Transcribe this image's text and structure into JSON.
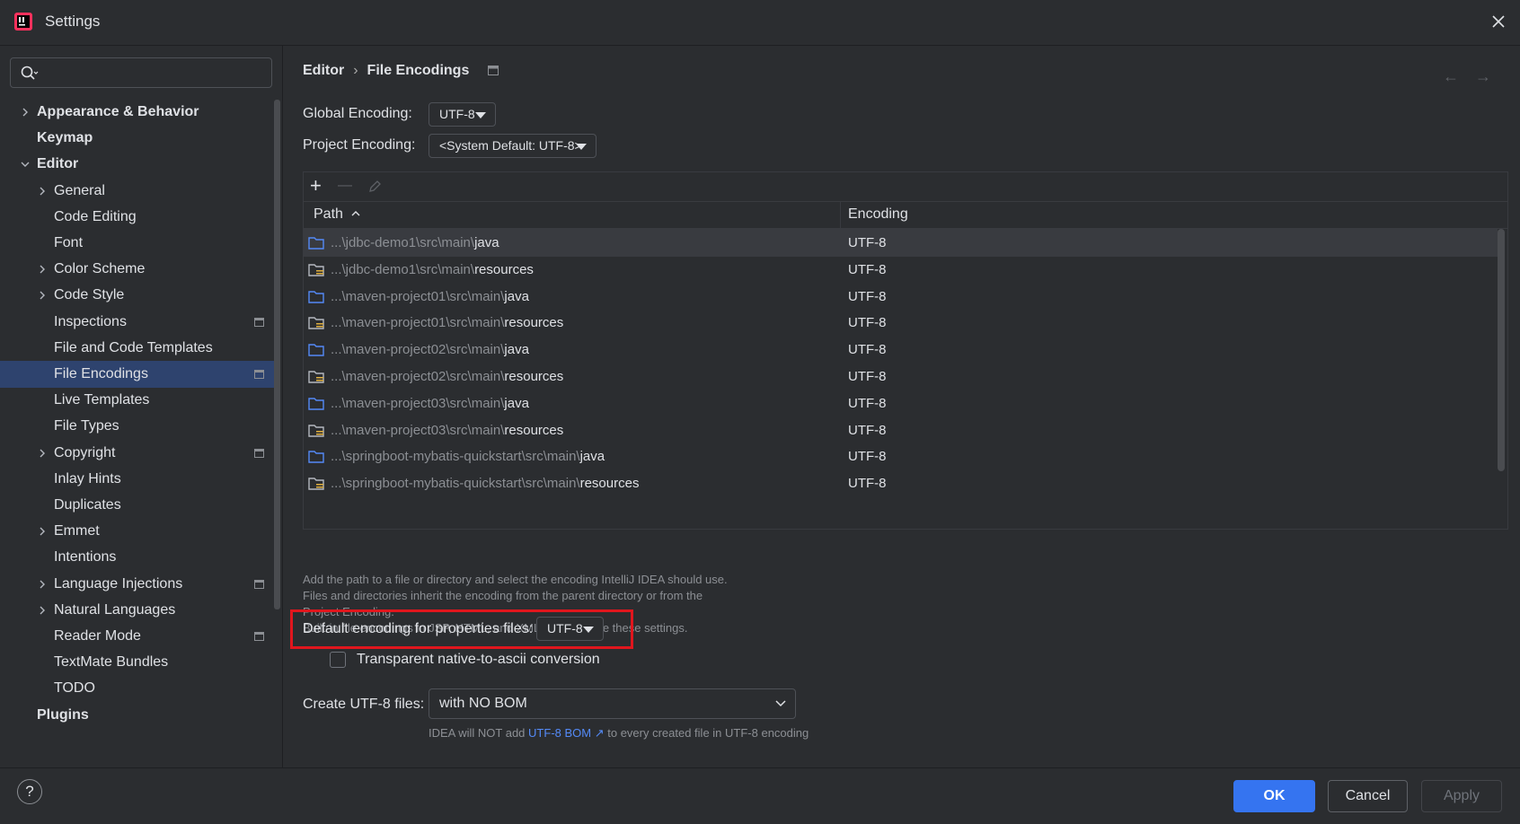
{
  "window": {
    "title": "Settings"
  },
  "search": {
    "placeholder": ""
  },
  "sidebar": {
    "items": [
      {
        "label": "Appearance & Behavior",
        "bold": true,
        "arrow": "right",
        "level": 0
      },
      {
        "label": "Keymap",
        "bold": true,
        "arrow": "",
        "level": 0
      },
      {
        "label": "Editor",
        "bold": true,
        "arrow": "down",
        "level": 0
      },
      {
        "label": "General",
        "arrow": "right",
        "level": 1
      },
      {
        "label": "Code Editing",
        "arrow": "",
        "level": 1
      },
      {
        "label": "Font",
        "arrow": "",
        "level": 1
      },
      {
        "label": "Color Scheme",
        "arrow": "right",
        "level": 1
      },
      {
        "label": "Code Style",
        "arrow": "right",
        "level": 1
      },
      {
        "label": "Inspections",
        "arrow": "",
        "level": 1,
        "pin": true
      },
      {
        "label": "File and Code Templates",
        "arrow": "",
        "level": 1
      },
      {
        "label": "File Encodings",
        "arrow": "",
        "level": 1,
        "pin": true,
        "selected": true
      },
      {
        "label": "Live Templates",
        "arrow": "",
        "level": 1
      },
      {
        "label": "File Types",
        "arrow": "",
        "level": 1
      },
      {
        "label": "Copyright",
        "arrow": "right",
        "level": 1,
        "pin": true
      },
      {
        "label": "Inlay Hints",
        "arrow": "",
        "level": 1
      },
      {
        "label": "Duplicates",
        "arrow": "",
        "level": 1
      },
      {
        "label": "Emmet",
        "arrow": "right",
        "level": 1
      },
      {
        "label": "Intentions",
        "arrow": "",
        "level": 1
      },
      {
        "label": "Language Injections",
        "arrow": "right",
        "level": 1,
        "pin": true
      },
      {
        "label": "Natural Languages",
        "arrow": "right",
        "level": 1
      },
      {
        "label": "Reader Mode",
        "arrow": "",
        "level": 1,
        "pin": true
      },
      {
        "label": "TextMate Bundles",
        "arrow": "",
        "level": 1
      },
      {
        "label": "TODO",
        "arrow": "",
        "level": 1
      },
      {
        "label": "Plugins",
        "bold": true,
        "arrow": "",
        "level": 0
      }
    ]
  },
  "breadcrumb": {
    "parent": "Editor",
    "separator": "›",
    "current": "File Encodings"
  },
  "global_encoding": {
    "label": "Global Encoding:",
    "value": "UTF-8"
  },
  "project_encoding": {
    "label": "Project Encoding:",
    "value": "<System Default: UTF-8>"
  },
  "table": {
    "toolbar": {
      "add": "+",
      "remove": "—"
    },
    "headers": {
      "path": "Path",
      "encoding": "Encoding"
    },
    "rows": [
      {
        "dim": "...\\jdbc-demo1\\src\\main\\",
        "name": "java",
        "type": "folder",
        "encoding": "UTF-8"
      },
      {
        "dim": "...\\jdbc-demo1\\src\\main\\",
        "name": "resources",
        "type": "resources",
        "encoding": "UTF-8"
      },
      {
        "dim": "...\\maven-project01\\src\\main\\",
        "name": "java",
        "type": "folder",
        "encoding": "UTF-8"
      },
      {
        "dim": "...\\maven-project01\\src\\main\\",
        "name": "resources",
        "type": "resources",
        "encoding": "UTF-8"
      },
      {
        "dim": "...\\maven-project02\\src\\main\\",
        "name": "java",
        "type": "folder",
        "encoding": "UTF-8"
      },
      {
        "dim": "...\\maven-project02\\src\\main\\",
        "name": "resources",
        "type": "resources",
        "encoding": "UTF-8"
      },
      {
        "dim": "...\\maven-project03\\src\\main\\",
        "name": "java",
        "type": "folder",
        "encoding": "UTF-8"
      },
      {
        "dim": "...\\maven-project03\\src\\main\\",
        "name": "resources",
        "type": "resources",
        "encoding": "UTF-8"
      },
      {
        "dim": "...\\springboot-mybatis-quickstart\\src\\main\\",
        "name": "java",
        "type": "folder",
        "encoding": "UTF-8"
      },
      {
        "dim": "...\\springboot-mybatis-quickstart\\src\\main\\",
        "name": "resources",
        "type": "resources",
        "encoding": "UTF-8"
      }
    ]
  },
  "hint_lines": [
    "Add the path to a file or directory and select the encoding IntelliJ IDEA should use.",
    "Files and directories inherit the encoding from the parent directory or from the",
    "Project Encoding.",
    "Built-in file encodings in JSP, HTML, and XML files override these settings."
  ],
  "properties_encoding": {
    "label": "Default encoding for properties files:",
    "value": "UTF-8"
  },
  "native_to_ascii": {
    "label": "Transparent native-to-ascii conversion",
    "checked": false
  },
  "create_utf8": {
    "label": "Create UTF-8 files:",
    "value": "with NO BOM"
  },
  "bom_note": {
    "prefix": "IDEA will NOT add",
    "link": "UTF-8 BOM ↗",
    "suffix": "to every created file in UTF-8 encoding"
  },
  "footer": {
    "help": "?",
    "ok": "OK",
    "cancel": "Cancel",
    "apply": "Apply"
  },
  "colors": {
    "background": "#2b2d30",
    "selection": "#2e436e",
    "accent": "#3574f0",
    "highlight": "#e0161d",
    "link": "#548af7"
  }
}
